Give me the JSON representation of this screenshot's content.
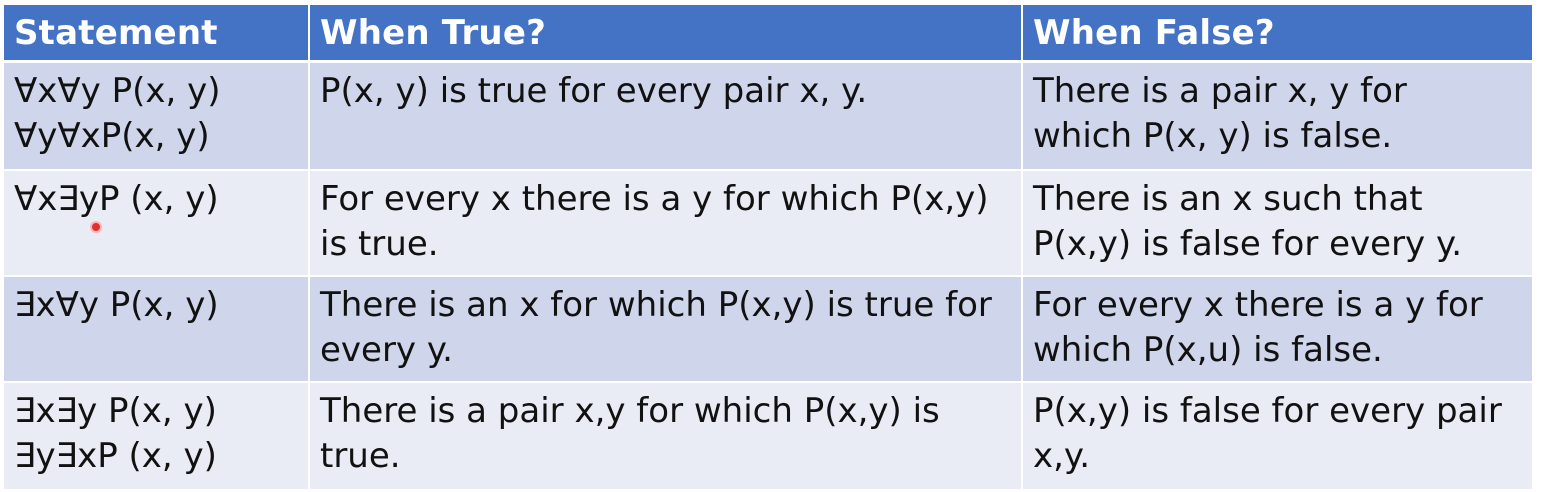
{
  "table": {
    "headers": [
      "Statement",
      "When True?",
      "When False?"
    ],
    "rows": [
      {
        "statement": [
          "∀x∀y P(x, y)",
          "∀y∀xP(x, y)"
        ],
        "when_true": [
          "P(x, y) is true for every pair x, y."
        ],
        "when_false": [
          "There is a pair x, y for",
          "which P(x, y) is false."
        ]
      },
      {
        "statement": [
          "∀x∃yP (x, y)"
        ],
        "when_true": [
          "For every x there is a y for which P(x,y)",
          "is true."
        ],
        "when_false": [
          "There is an x such that",
          "P(x,y) is false for every y."
        ]
      },
      {
        "statement": [
          "∃x∀y P(x, y)"
        ],
        "when_true": [
          "There is an x for which P(x,y) is true for",
          "every y."
        ],
        "when_false": [
          "For every x there is a y for",
          "which P(x,u) is false."
        ]
      },
      {
        "statement": [
          "∃x∃y P(x, y)",
          "∃y∃xP (x, y)"
        ],
        "when_true": [
          "There is a pair x,y for which P(x,y) is",
          "true."
        ],
        "when_false": [
          "P(x,y) is false for every pair",
          "x,y."
        ]
      }
    ]
  },
  "colors": {
    "header": "#4472c4",
    "row_odd": "#cfd5ea",
    "row_even": "#e9ebf5",
    "cursor": "#e03030"
  }
}
